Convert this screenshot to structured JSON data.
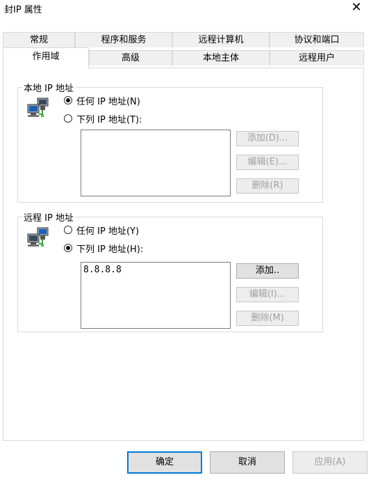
{
  "window": {
    "title": "封IP 属性",
    "close_glyph": "✕"
  },
  "tabs": {
    "row1": [
      "常规",
      "程序和服务",
      "远程计算机",
      "协议和端口"
    ],
    "row2": [
      "作用域",
      "高级",
      "本地主体",
      "远程用户"
    ],
    "active": "作用域"
  },
  "local": {
    "title": "本地 IP 地址",
    "radio_any": "任何 IP 地址(N)",
    "radio_list": "下列 IP 地址(T):",
    "selected": "any",
    "addresses": [],
    "add": "添加(D)...",
    "edit": "编辑(E)...",
    "remove": "删除(R)"
  },
  "remote": {
    "title": "远程 IP 地址",
    "radio_any": "任何 IP 地址(Y)",
    "radio_list": "下列 IP 地址(H):",
    "selected": "list",
    "addresses": [
      "8.8.8.8"
    ],
    "add": "添加..",
    "edit": "编辑(I)...",
    "remove": "删除(M)"
  },
  "footer": {
    "ok": "确定",
    "cancel": "取消",
    "apply": "应用(A)"
  }
}
